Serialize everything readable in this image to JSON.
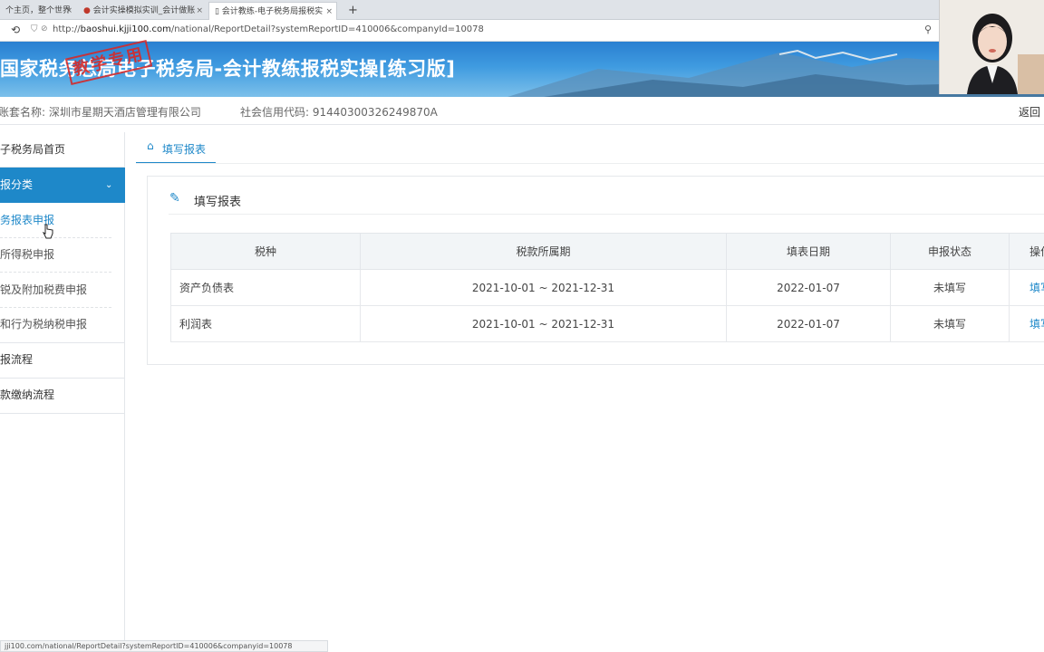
{
  "browser": {
    "tabs": [
      {
        "label": "个主页，整个世界",
        "active": false
      },
      {
        "label": "会计实操模拟实训_会计做账",
        "active": false
      },
      {
        "label": "会计教练-电子税务局报税实",
        "active": true
      }
    ],
    "new_tab_label": "+",
    "close_glyph": "×",
    "url_host": "baoshui.kjji100.com",
    "url_scheme": "http://",
    "url_path": "/national/ReportDetail?systemReportID=410006&companyId=10078",
    "status_url": "jji100.com/national/ReportDetail?systemReportID=410006&companyid=10078"
  },
  "banner": {
    "title": "国家税务总局电子税务局-会计教练报税实操[练习版]",
    "stamp": "教学专用"
  },
  "info": {
    "account_label": "账套名称: 深圳市星期天酒店管理有限公司",
    "credit_code_label": "社会信用代码: 91440300326249870A",
    "back_label": "返回"
  },
  "sidebar": {
    "home": "子税务局首页",
    "category": "报分类",
    "sub_items": [
      "务报表申报",
      "所得税申报",
      "锐及附加税费申报",
      "和行为税纳税申报"
    ],
    "flow1": "报流程",
    "flow2": "款缴纳流程"
  },
  "main": {
    "tab_label": "填写报表",
    "section_title": "填写报表",
    "columns": [
      "税种",
      "税款所属期",
      "填表日期",
      "申报状态",
      "操作"
    ],
    "rows": [
      {
        "tax": "资产负债表",
        "period": "2021-10-01 ~ 2021-12-31",
        "date": "2022-01-07",
        "status": "未填写",
        "action": "填写"
      },
      {
        "tax": "利润表",
        "period": "2021-10-01 ~ 2021-12-31",
        "date": "2022-01-07",
        "status": "未填写",
        "action": "填写"
      }
    ]
  },
  "colors": {
    "accent": "#1e88c9",
    "banner": "#2a7fd1",
    "stamp": "#d42a2a"
  }
}
